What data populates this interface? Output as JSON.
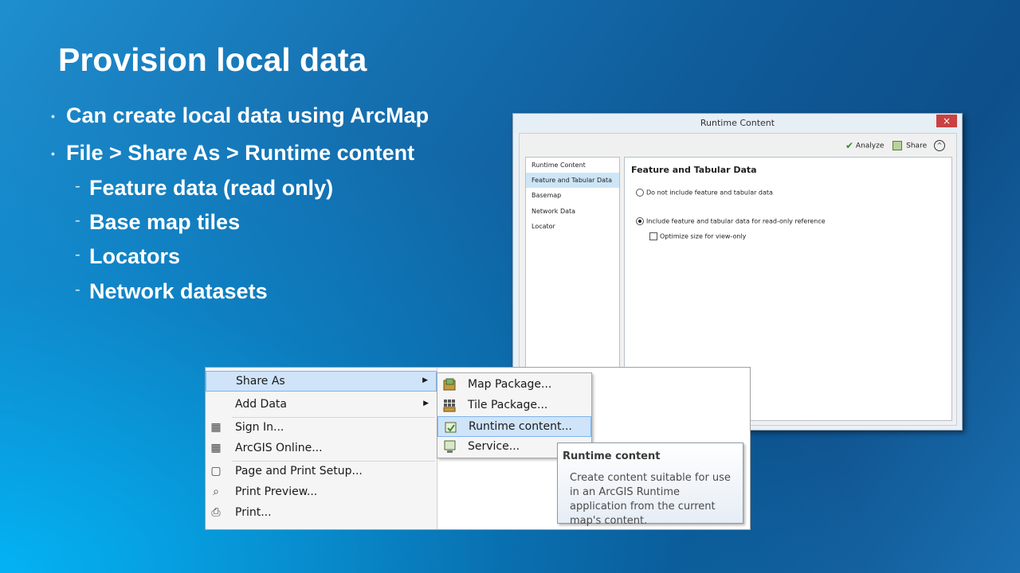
{
  "slide": {
    "title": "Provision local data",
    "bullets": [
      {
        "text": "Can create local data using ArcMap"
      },
      {
        "text": "File > Share As > Runtime content"
      }
    ],
    "sub_bullets": [
      {
        "text": "Feature data (read only)"
      },
      {
        "text": "Base map tiles"
      },
      {
        "text": "Locators"
      },
      {
        "text": "Network datasets"
      }
    ],
    "bullet_glyph": "•",
    "sub_bullet_glyph": "-"
  },
  "dialog": {
    "title": "Runtime Content",
    "close_glyph": "×",
    "toolbar": {
      "analyze_label": "Analyze",
      "share_label": "Share",
      "analyze_icon": "checkmark-icon",
      "share_icon": "share-icon",
      "collapse_glyph": "^"
    },
    "nav": [
      {
        "label": "Runtime Content",
        "selected": false
      },
      {
        "label": "Feature and Tabular Data",
        "selected": true
      },
      {
        "label": "Basemap",
        "selected": false
      },
      {
        "label": "Network Data",
        "selected": false
      },
      {
        "label": "Locator",
        "selected": false
      }
    ],
    "content": {
      "heading": "Feature and Tabular Data",
      "option_exclude": "Do not include feature and tabular data",
      "option_include": "Include feature and tabular data for read-only reference",
      "option_optimize": "Optimize size for view-only",
      "selected_option": "include",
      "optimize_checked": false
    }
  },
  "file_menu": {
    "items": [
      {
        "label": "Share As",
        "icon": null,
        "has_submenu": true,
        "highlighted": true
      },
      {
        "label": "Add Data",
        "icon": null,
        "has_submenu": true,
        "highlighted": false
      },
      {
        "label": "Sign In...",
        "icon": "grid-icon"
      },
      {
        "label": "ArcGIS Online...",
        "icon": "grid-icon"
      },
      {
        "label": "Page and Print Setup...",
        "icon": "page-setup-icon"
      },
      {
        "label": "Print Preview...",
        "icon": "print-preview-icon"
      },
      {
        "label": "Print...",
        "icon": "printer-icon"
      }
    ],
    "submenu_arrow": "▶"
  },
  "share_submenu": {
    "items": [
      {
        "label": "Map Package...",
        "icon": "map-package-icon"
      },
      {
        "label": "Tile Package...",
        "icon": "tile-package-icon"
      },
      {
        "label": "Runtime content...",
        "icon": "runtime-content-icon",
        "highlighted": true
      },
      {
        "label": "Service...",
        "icon": "service-icon"
      }
    ]
  },
  "tooltip": {
    "title": "Runtime content",
    "body": "Create content suitable for use in an ArcGIS Runtime application from the current map's content."
  }
}
